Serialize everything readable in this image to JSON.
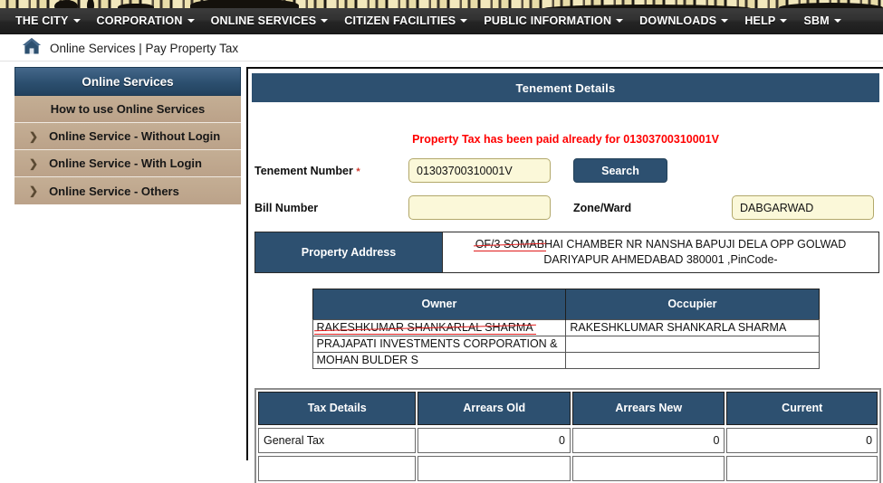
{
  "nav": {
    "items": [
      {
        "label": "THE CITY",
        "has_caret": true
      },
      {
        "label": "CORPORATION",
        "has_caret": true
      },
      {
        "label": "ONLINE SERVICES",
        "has_caret": true
      },
      {
        "label": "CITIZEN FACILITIES",
        "has_caret": true
      },
      {
        "label": "PUBLIC INFORMATION",
        "has_caret": true
      },
      {
        "label": "DOWNLOADS",
        "has_caret": true
      },
      {
        "label": "HELP",
        "has_caret": true
      },
      {
        "label": "SBM",
        "has_caret": true
      }
    ]
  },
  "breadcrumb": {
    "icon": "home-icon",
    "text": "Online Services | Pay Property Tax"
  },
  "sidebar": {
    "header": "Online Services",
    "items": [
      {
        "label": "How to use Online Services",
        "arrow": ""
      },
      {
        "label": "Online Service - Without Login",
        "arrow": "❯"
      },
      {
        "label": "Online Service - With Login",
        "arrow": "❯"
      },
      {
        "label": "Online Service - Others",
        "arrow": "❯"
      }
    ]
  },
  "main": {
    "panel_title": "Tenement Details",
    "alert_message": "Property Tax has been paid already for 01303700310001V",
    "form": {
      "tenement_label": "Tenement Number",
      "tenement_required_mark": "*",
      "tenement_value": "01303700310001V",
      "tenement_placeholder": "",
      "search_button": "Search",
      "bill_label": "Bill Number",
      "bill_value": "",
      "bill_placeholder": "",
      "zone_label": "Zone/Ward",
      "zone_value": "DABGARWAD",
      "zone_placeholder": ""
    },
    "address": {
      "label": "Property Address",
      "prefix_flagged": "OF/3 SOMAB",
      "rest": "HAI CHAMBER NR NANSHA BAPUJI DELA OPP GOLWAD DARIYAPUR AHMEDABAD 380001 ,PinCode-"
    },
    "owner_table": {
      "headers": [
        "Owner",
        "Occupier"
      ],
      "rows": [
        {
          "owner": "RAKESHKUMAR SHANKARLAL SHARMA",
          "owner_flagged": true,
          "occupier": "RAKESHKLUMAR SHANKARLA SHARMA"
        },
        {
          "owner": "PRAJAPATI INVESTMENTS CORPORATION &",
          "owner_flagged": false,
          "occupier": ""
        },
        {
          "owner": "MOHAN BULDER S",
          "owner_flagged": false,
          "occupier": ""
        }
      ]
    },
    "tax_table": {
      "headers": [
        "Tax Details",
        "Arrears Old",
        "Arrears New",
        "Current"
      ],
      "rows": [
        {
          "name": "General Tax",
          "arrears_old": "0",
          "arrears_new": "0",
          "current": "0"
        }
      ]
    }
  },
  "colors": {
    "nav_bg": "#2f2f2f",
    "panel_header_blue": "#2d5070",
    "sidebar_item_tan": "#bba289",
    "input_yellow": "#fbf8d9",
    "alert_red": "#ff0000",
    "spellcheck_red": "#e01b1b"
  }
}
